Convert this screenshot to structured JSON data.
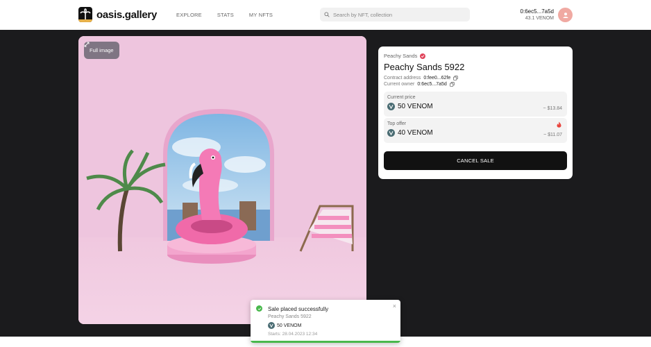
{
  "header": {
    "logo_text": "oasis.gallery",
    "nav": [
      "EXPLORE",
      "STATS",
      "MY NFTS"
    ],
    "search_placeholder": "Search by NFT, collection",
    "wallet_address": "0:6ec5...7a5d",
    "wallet_balance": "43.1 VENOM"
  },
  "artwork": {
    "full_image_label": "Full image"
  },
  "nft": {
    "collection": "Peachy Sands",
    "title": "Peachy Sands 5922",
    "contract_label": "Contract address",
    "contract_value": "0:fee0...62fe",
    "owner_label": "Current owner",
    "owner_value": "0:6ec5...7a5d",
    "current_price_label": "Current price",
    "current_price": "50 VENOM",
    "current_price_usd": "~ $13.84",
    "top_offer_label": "Top offer",
    "top_offer": "40 VENOM",
    "top_offer_usd": "~ $11.07",
    "cancel_label": "CANCEL SALE"
  },
  "toast": {
    "title": "Sale placed successfully",
    "subtitle": "Peachy Sands 5922",
    "price": "50 VENOM",
    "starts": "Starts: 28.04.2023 12:34",
    "close": "×",
    "progress": 1.0
  },
  "colors": {
    "accent": "#111111",
    "verified": "#e0455b",
    "success": "#48b84c",
    "artwork_bg": "#efc6df"
  }
}
